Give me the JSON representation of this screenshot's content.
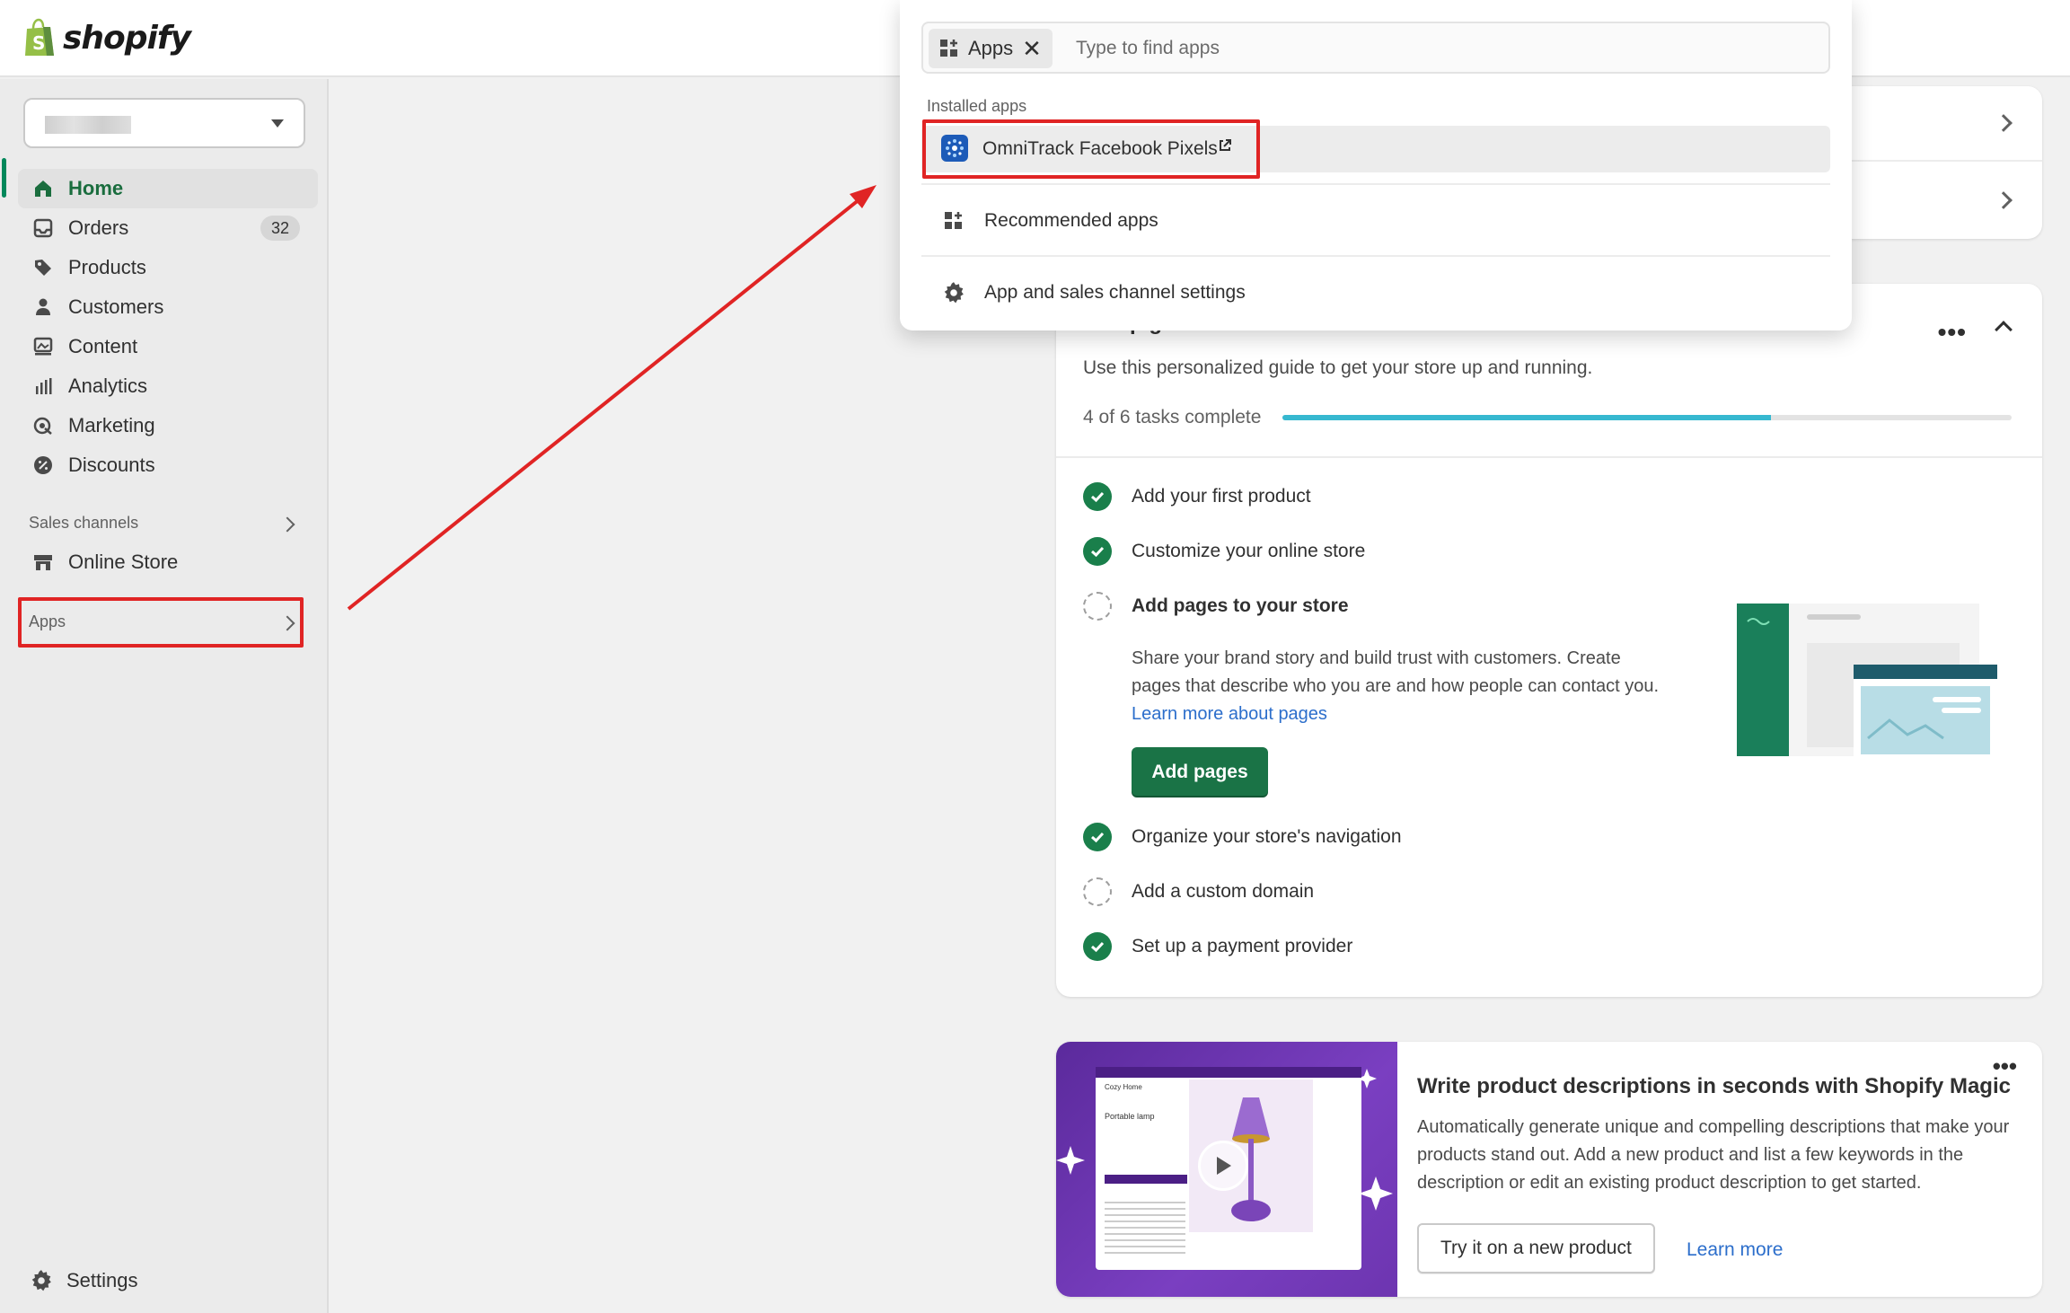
{
  "brand": {
    "name": "shopify",
    "accent": "#1a7346"
  },
  "sidebar": {
    "store_name": "",
    "items": [
      {
        "label": "Home",
        "icon": "home-icon"
      },
      {
        "label": "Orders",
        "icon": "inbox-icon",
        "badge": "32"
      },
      {
        "label": "Products",
        "icon": "tag-icon"
      },
      {
        "label": "Customers",
        "icon": "person-icon"
      },
      {
        "label": "Content",
        "icon": "image-icon"
      },
      {
        "label": "Analytics",
        "icon": "bar-chart-icon"
      },
      {
        "label": "Marketing",
        "icon": "target-icon"
      },
      {
        "label": "Discounts",
        "icon": "discount-icon"
      }
    ],
    "sales_channels_label": "Sales channels",
    "online_store_label": "Online Store",
    "apps_label": "Apps",
    "settings_label": "Settings"
  },
  "app_search": {
    "chip_label": "Apps",
    "placeholder": "Type to find apps",
    "installed_label": "Installed apps",
    "installed_app": "OmniTrack Facebook Pixels",
    "recommended_label": "Recommended apps",
    "settings_label": "App and sales channel settings"
  },
  "setup_guide": {
    "title": "Setup guide",
    "description": "Use this personalized guide to get your store up and running.",
    "progress_text": "4 of 6 tasks complete",
    "progress": 0.67,
    "tasks": [
      {
        "label": "Add your first product",
        "done": true
      },
      {
        "label": "Customize your online store",
        "done": true
      },
      {
        "label": "Add pages to your store",
        "done": false
      },
      {
        "label": "Organize your store's navigation",
        "done": true
      },
      {
        "label": "Add a custom domain",
        "done": false
      },
      {
        "label": "Set up a payment provider",
        "done": true
      }
    ],
    "current_body": "Share your brand story and build trust with customers. Create pages that describe who you are and how people can contact you.",
    "current_link": "Learn more about pages",
    "current_button": "Add pages"
  },
  "magic_card": {
    "title": "Write product descriptions in seconds with Shopify Magic",
    "description": "Automatically generate unique and compelling descriptions that make your products stand out. Add a new product and list a few keywords in the description or edit an existing product description to get started.",
    "primary_button": "Try it on a new product",
    "link": "Learn more",
    "mock_store_name": "Cozy Home",
    "mock_product_name": "Portable lamp"
  }
}
